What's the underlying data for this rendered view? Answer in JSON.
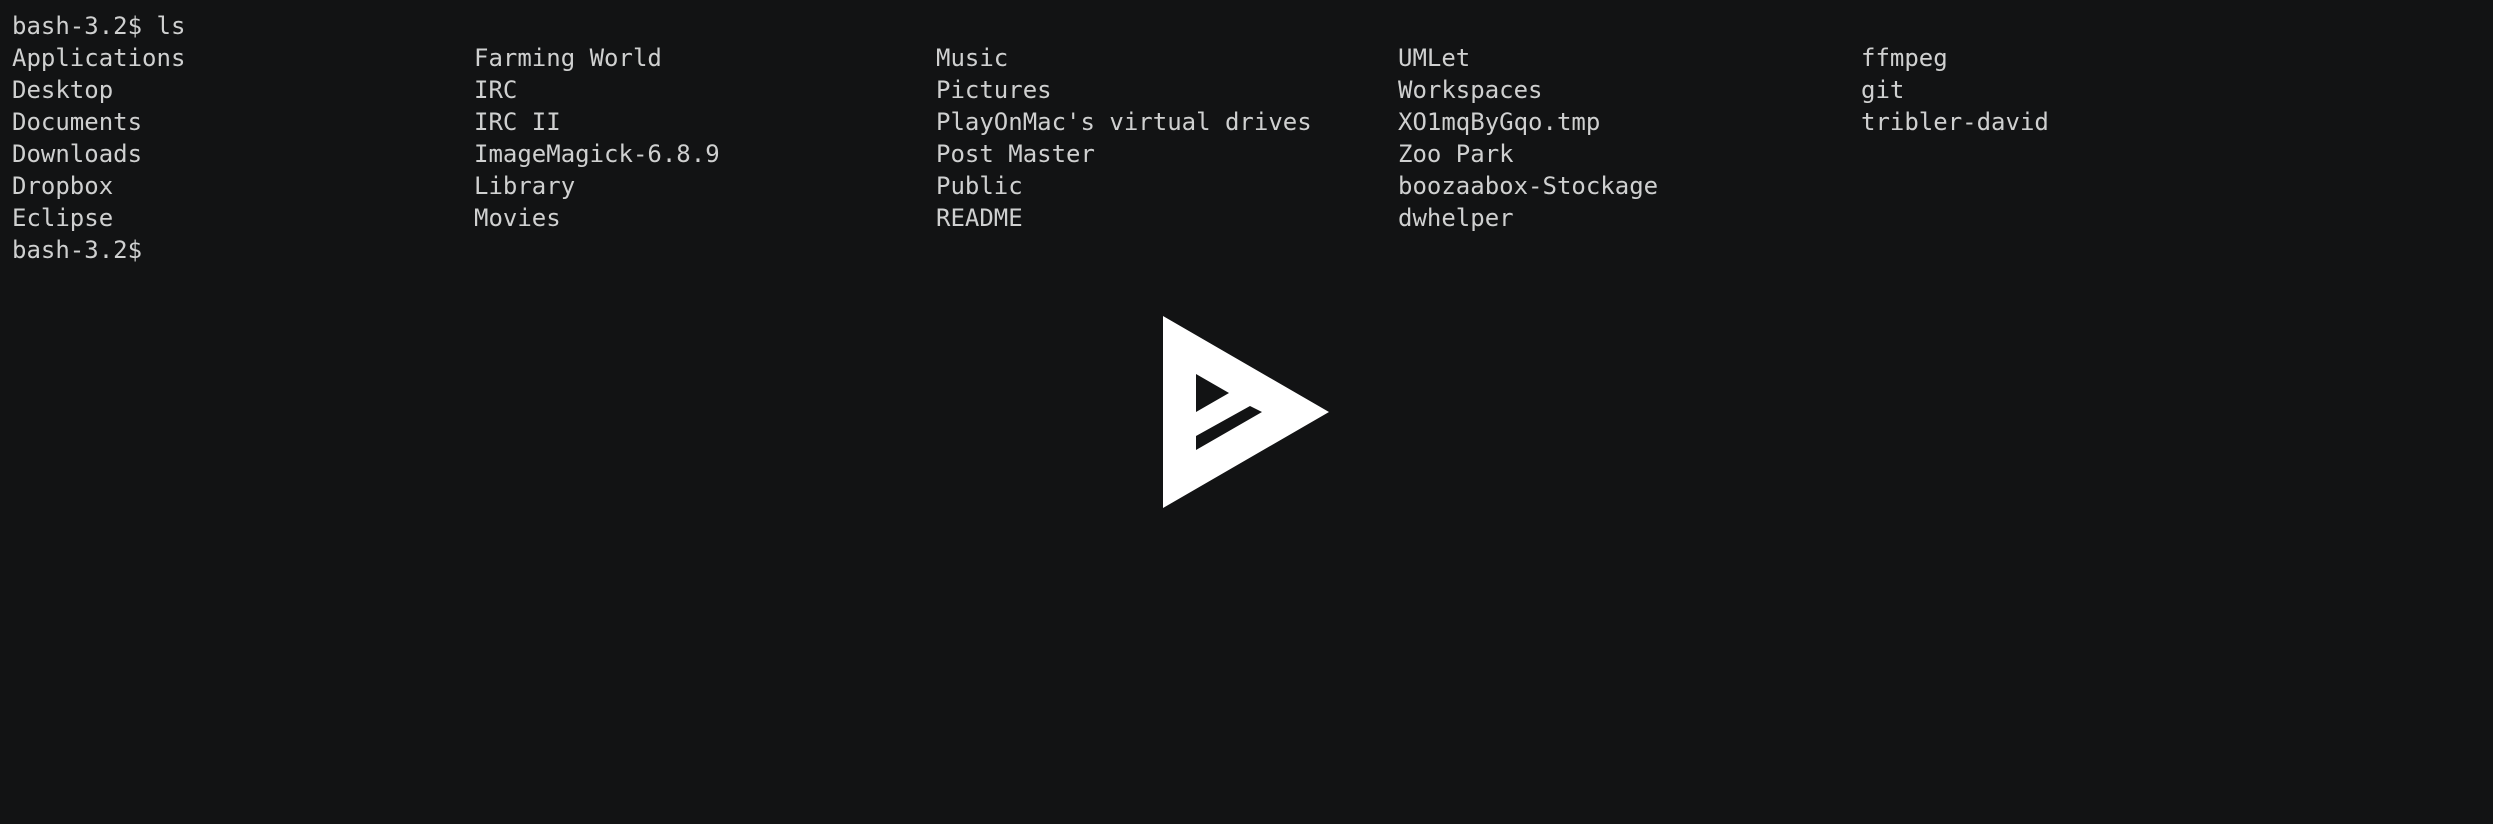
{
  "terminal": {
    "command_line": "bash-3.2$ ls",
    "listing": [
      [
        "Applications",
        "Farming World",
        "Music",
        "UMLet",
        "ffmpeg"
      ],
      [
        "Desktop",
        "IRC",
        "Pictures",
        "Workspaces",
        "git"
      ],
      [
        "Documents",
        "IRC II",
        "PlayOnMac's virtual drives",
        "XO1mqByGqo.tmp",
        "tribler-david"
      ],
      [
        "Downloads",
        "ImageMagick-6.8.9",
        "Post Master",
        "Zoo Park",
        ""
      ],
      [
        "Dropbox",
        "Library",
        "Public",
        "boozaabox-Stockage",
        ""
      ],
      [
        "Eclipse",
        "Movies",
        "README",
        "dwhelper",
        ""
      ]
    ],
    "prompt": "bash-3.2$"
  },
  "overlay": {
    "icon": "asciinema-play-icon",
    "color": "#ffffff"
  },
  "colors": {
    "background": "#121314",
    "text": "#cfd0d0"
  }
}
